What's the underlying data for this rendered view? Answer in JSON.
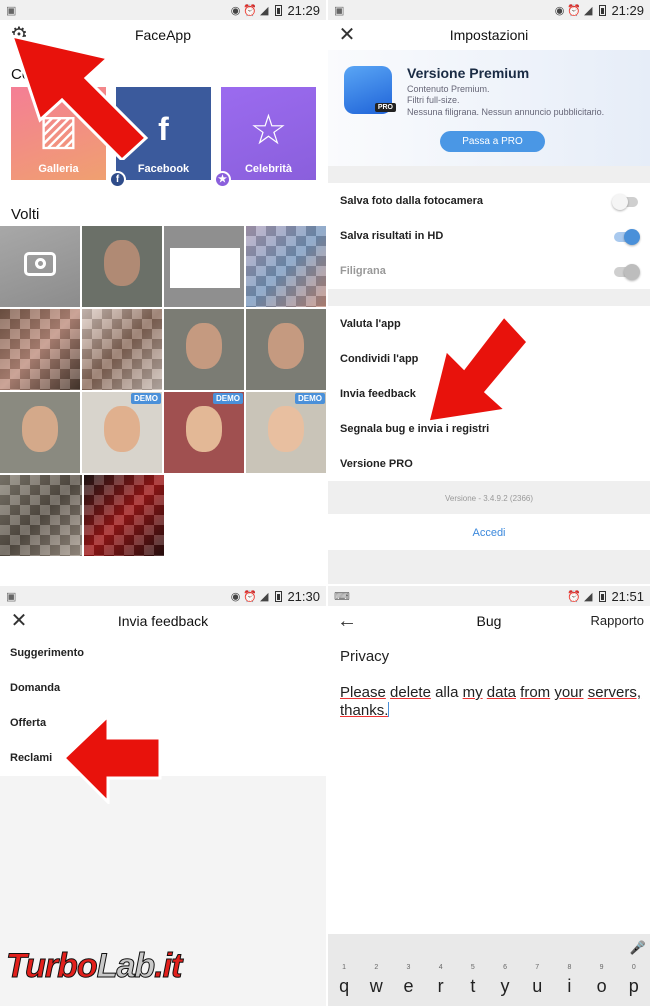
{
  "colors": {
    "accent_blue": "#4a97e5",
    "arrow_red": "#e8120c",
    "toggle_on": "#4a90d9"
  },
  "panel1": {
    "status": {
      "time": "21:29"
    },
    "app_title": "FaceApp",
    "collections_title": "Coll",
    "tiles": [
      {
        "label": "Galleria",
        "icon": "image-icon"
      },
      {
        "label": "Facebook",
        "icon": "facebook-icon"
      },
      {
        "label": "Celebrità",
        "icon": "star-icon"
      }
    ],
    "faces_title": "Volti",
    "demo_label": "DEMO",
    "settings_icon": "gear-icon"
  },
  "panel2": {
    "status": {
      "time": "21:29"
    },
    "title": "Impostazioni",
    "premium": {
      "title": "Versione Premium",
      "line1": "Contenuto Premium.",
      "line2": "Filtri full-size.",
      "line3": "Nessuna filigrana. Nessun annuncio pubblicitario.",
      "button": "Passa a PRO",
      "badge": "PRO"
    },
    "toggles": [
      {
        "label": "Salva foto dalla fotocamera",
        "on": false
      },
      {
        "label": "Salva risultati in HD",
        "on": true
      },
      {
        "label": "Filigrana",
        "on": true,
        "disabled": true
      }
    ],
    "menu": [
      "Valuta l'app",
      "Condividi l'app",
      "Invia feedback",
      "Segnala bug e invia i registri",
      "Versione PRO"
    ],
    "version": "Versione - 3.4.9.2 (2366)",
    "login": "Accedi"
  },
  "panel3": {
    "status": {
      "time": "21:30"
    },
    "title": "Invia feedback",
    "items": [
      "Suggerimento",
      "Domanda",
      "Offerta",
      "Reclami"
    ]
  },
  "panel4": {
    "status": {
      "time": "21:51"
    },
    "title": "Bug",
    "action": "Rapporto",
    "subject": "Privacy",
    "body": {
      "w1": "Please",
      "w2": "delete",
      "w3": "alla",
      "w4": "my",
      "w5": "data",
      "w6": "from",
      "w7": "your",
      "w8": "servers,",
      "w9": "thanks."
    },
    "keyboard": {
      "row": [
        "q",
        "w",
        "e",
        "r",
        "t",
        "y",
        "u",
        "i",
        "o",
        "p"
      ],
      "nums": [
        "1",
        "2",
        "3",
        "4",
        "5",
        "6",
        "7",
        "8",
        "9",
        "0"
      ]
    }
  },
  "watermark": {
    "part1": "Turbo",
    "part2": "Lab",
    "part3": ".it"
  }
}
